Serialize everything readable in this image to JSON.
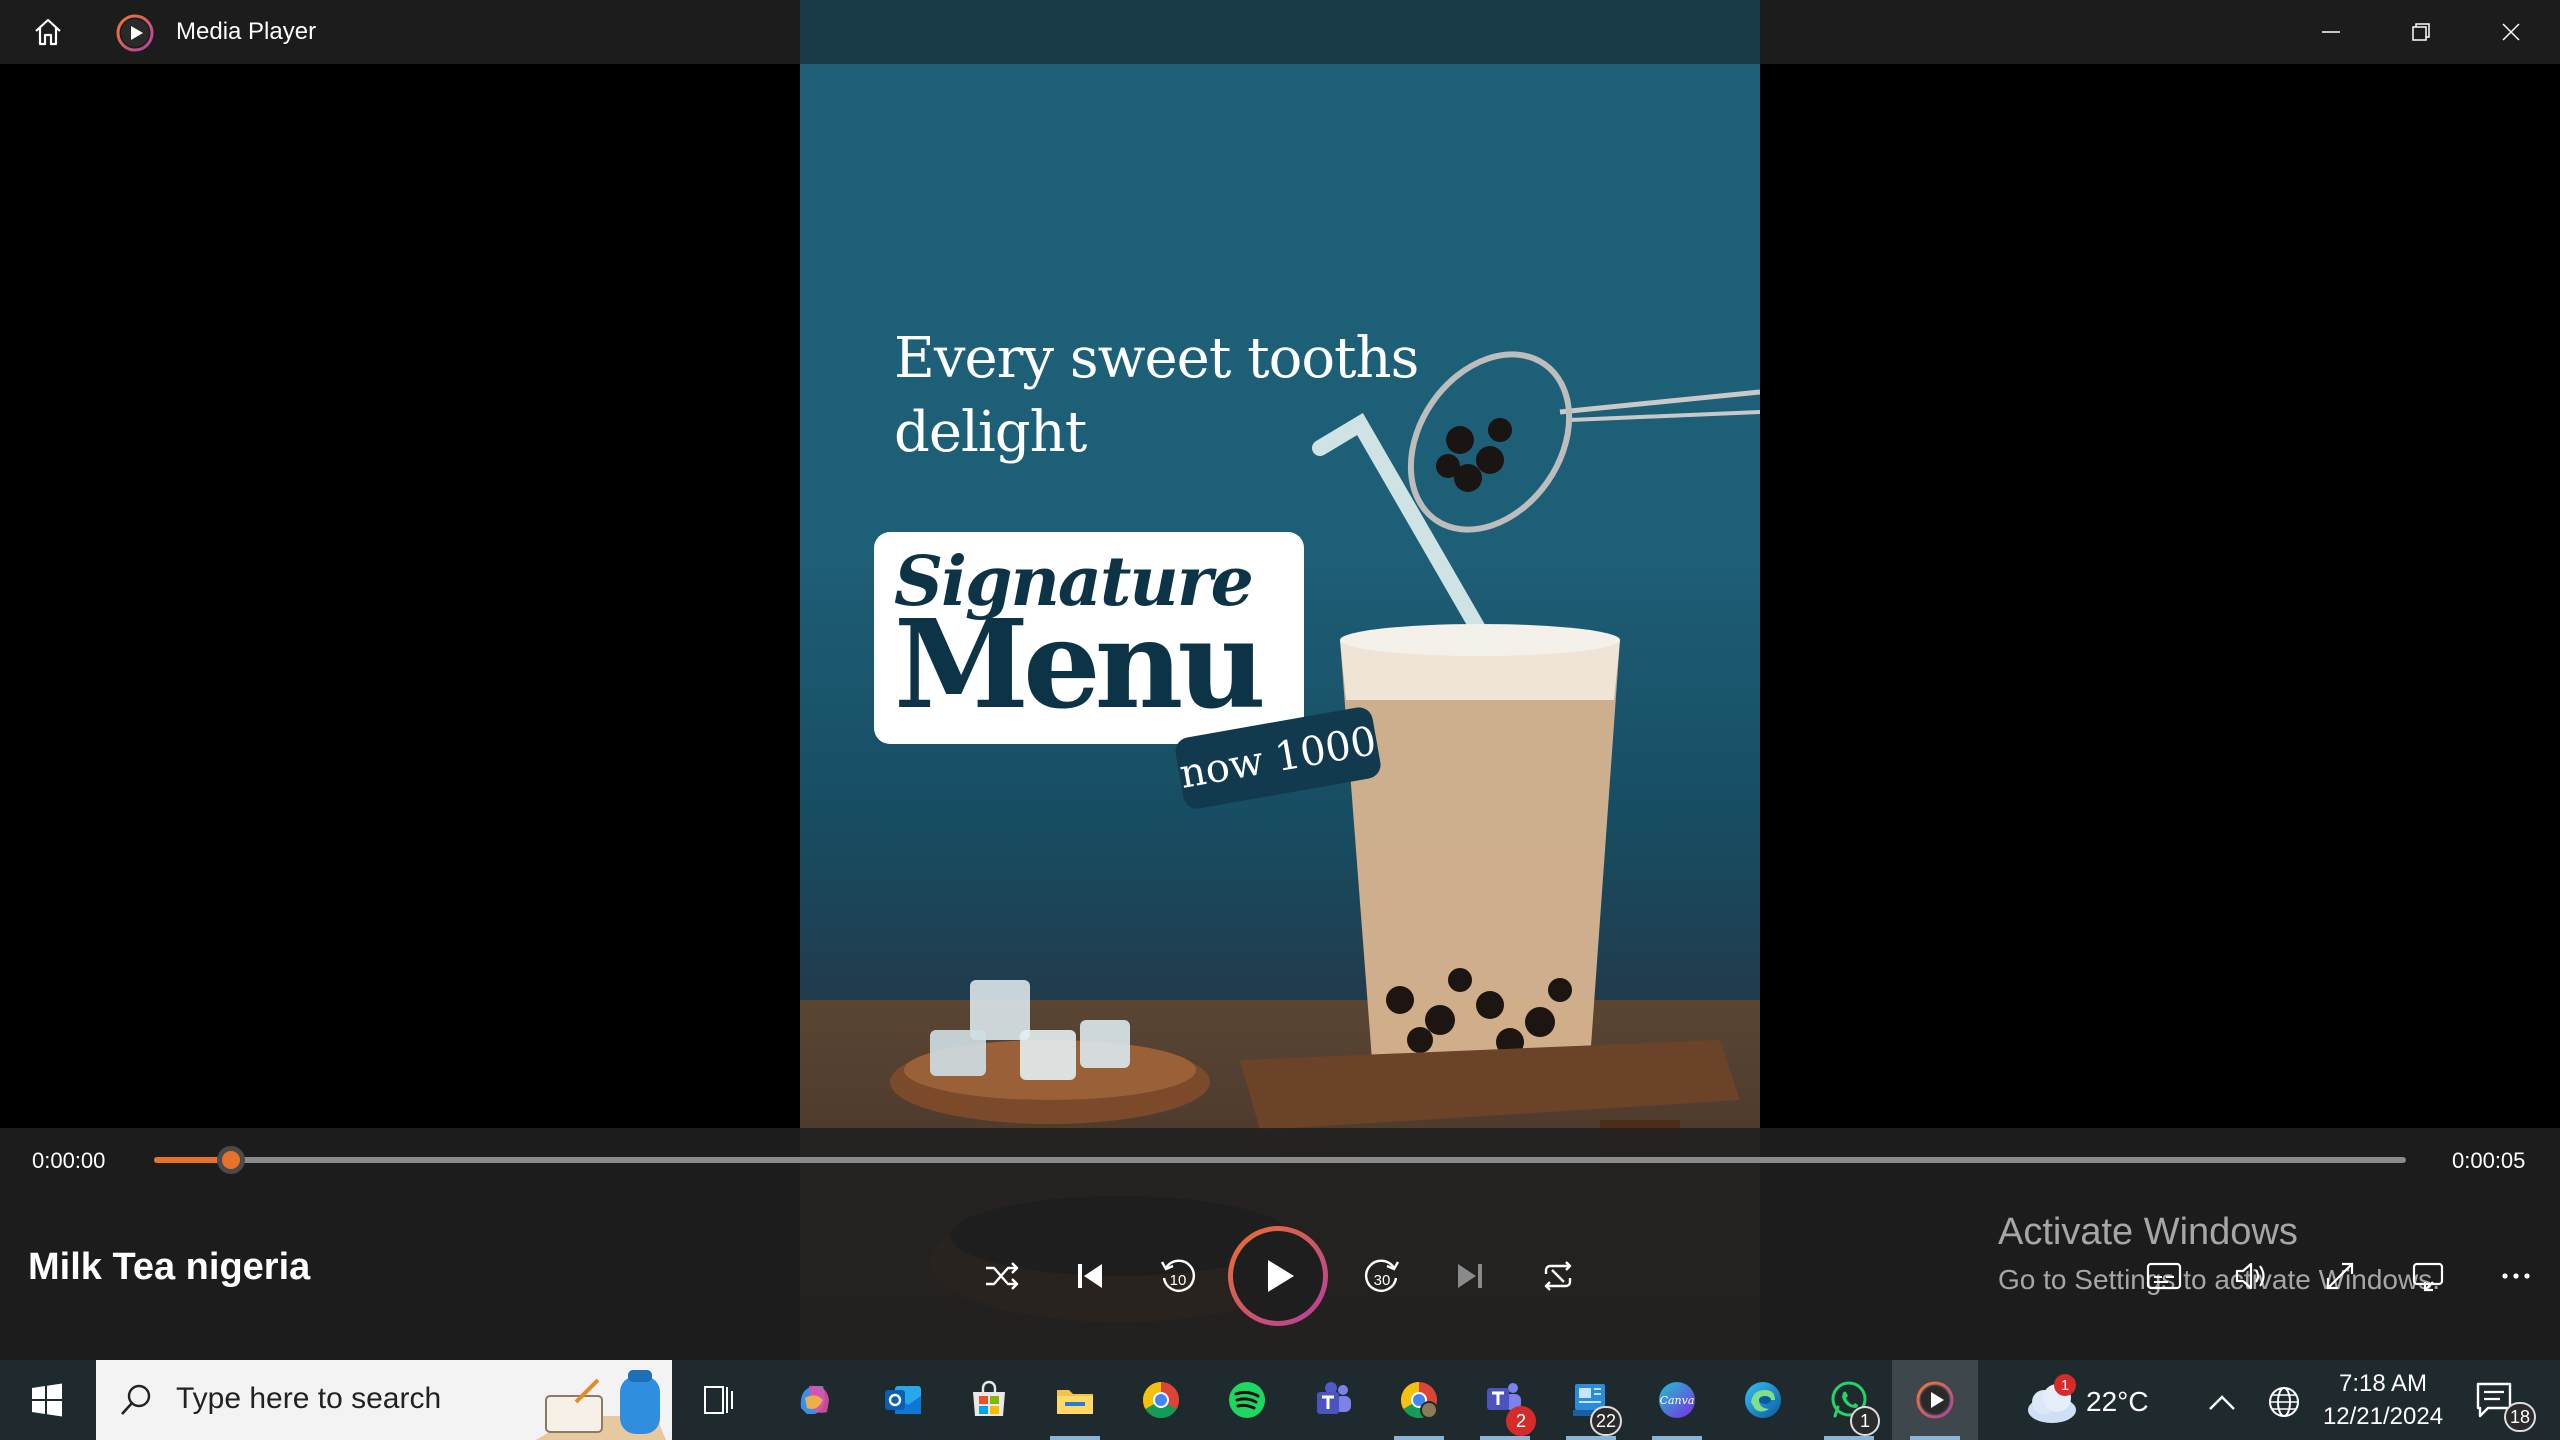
{
  "window": {
    "app_title": "Media Player",
    "icons": {
      "home": "home-icon",
      "app": "media-player-icon",
      "minimize": "minimize-icon",
      "restore": "restore-icon",
      "close": "close-icon"
    }
  },
  "video": {
    "headline_line1": "Every sweet tooths",
    "headline_line2": "delight",
    "card_script": "Signature",
    "card_bold": "Menu",
    "price_tag": "now 1000"
  },
  "player": {
    "current_time": "0:00:00",
    "total_time": "0:00:05",
    "progress_fraction": 0.034,
    "media_title": "Milk Tea nigeria",
    "accent_color": "#e8722c",
    "controls": [
      "shuffle-icon",
      "previous-icon",
      "rewind-10-icon",
      "play-icon",
      "forward-30-icon",
      "next-icon",
      "repeat-icon"
    ],
    "rewind_label": "10",
    "forward_label": "30",
    "right_controls": [
      "captions-icon",
      "volume-icon",
      "fullscreen-icon",
      "miniplayer-icon",
      "more-icon"
    ]
  },
  "watermark": {
    "title": "Activate Windows",
    "subtitle": "Go to Settings to activate Windows."
  },
  "taskbar": {
    "search_placeholder": "Type here to search",
    "apps": [
      {
        "name": "task-view-icon",
        "badge": ""
      },
      {
        "name": "copilot-icon",
        "badge": ""
      },
      {
        "name": "outlook-icon",
        "badge": ""
      },
      {
        "name": "microsoft-store-icon",
        "badge": ""
      },
      {
        "name": "file-explorer-icon",
        "badge": ""
      },
      {
        "name": "chrome-icon",
        "badge": ""
      },
      {
        "name": "spotify-icon",
        "badge": ""
      },
      {
        "name": "teams-icon",
        "badge": ""
      },
      {
        "name": "chrome-profile-icon",
        "badge": ""
      },
      {
        "name": "teams-classic-icon",
        "badge": "2"
      },
      {
        "name": "news-icon",
        "badge": "22"
      },
      {
        "name": "canva-icon",
        "badge": ""
      },
      {
        "name": "edge-icon",
        "badge": ""
      },
      {
        "name": "whatsapp-icon",
        "badge": "1"
      },
      {
        "name": "media-player-icon",
        "badge": ""
      }
    ],
    "weather_badge": "1",
    "temperature": "22°C",
    "time": "7:18 AM",
    "date": "12/21/2024",
    "notifications": "18",
    "canva_label": "Canva"
  }
}
